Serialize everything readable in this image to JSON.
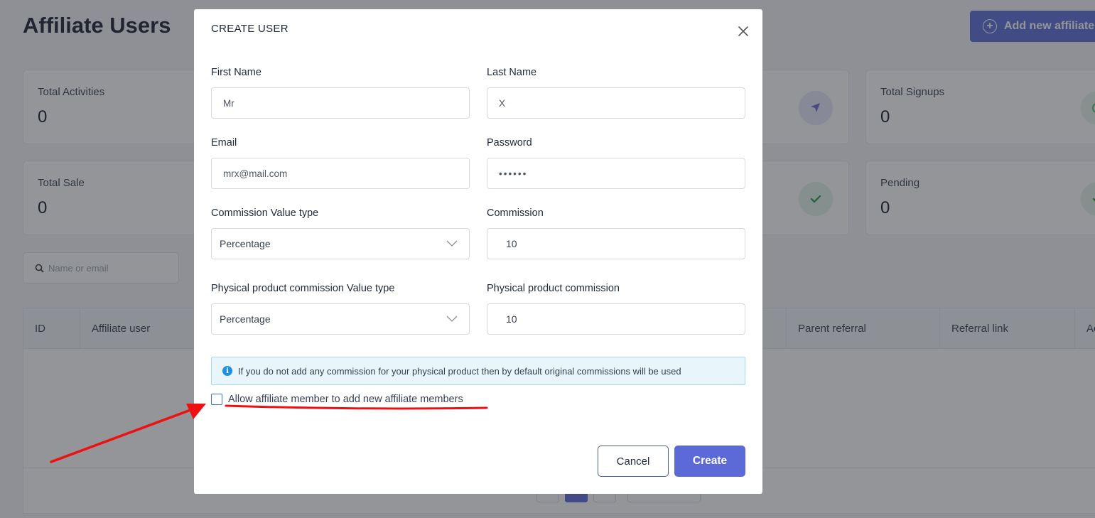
{
  "page": {
    "title": "Affiliate Users",
    "add_button": "Add new affiliate"
  },
  "cards": [
    {
      "label": "Total Activities",
      "value": "0"
    },
    {
      "label": "Total Signups",
      "value": "0"
    },
    {
      "label": "Total Sale",
      "value": "0"
    },
    {
      "label": "Pending",
      "value": "0"
    }
  ],
  "search": {
    "placeholder": "Name or email"
  },
  "table": {
    "columns": [
      "ID",
      "Affiliate user",
      "Parent referral",
      "Referral link",
      "Ac"
    ]
  },
  "modal": {
    "title": "CREATE USER",
    "first_name": {
      "label": "First Name",
      "value": "Mr"
    },
    "last_name": {
      "label": "Last Name",
      "value": "X"
    },
    "email": {
      "label": "Email",
      "value": "mrx@mail.com"
    },
    "password": {
      "label": "Password",
      "value": "••••••"
    },
    "commission_type": {
      "label": "Commission Value type",
      "value": "Percentage"
    },
    "commission": {
      "label": "Commission",
      "value": "10"
    },
    "physical_type": {
      "label": "Physical product commission Value type",
      "value": "Percentage"
    },
    "physical_commission": {
      "label": "Physical product commission",
      "value": "10"
    },
    "info_text": "If you do not add any commission for your physical product then by default original commissions will be used",
    "checkbox_label": "Allow affiliate member to add new affiliate members",
    "checkbox_checked": false,
    "cancel_label": "Cancel",
    "create_label": "Create"
  },
  "colors": {
    "primary": "#5b6ad6",
    "annotation": "#ee1111",
    "info_bg": "#e8f6fb",
    "info_icon": "#1e90e6"
  }
}
